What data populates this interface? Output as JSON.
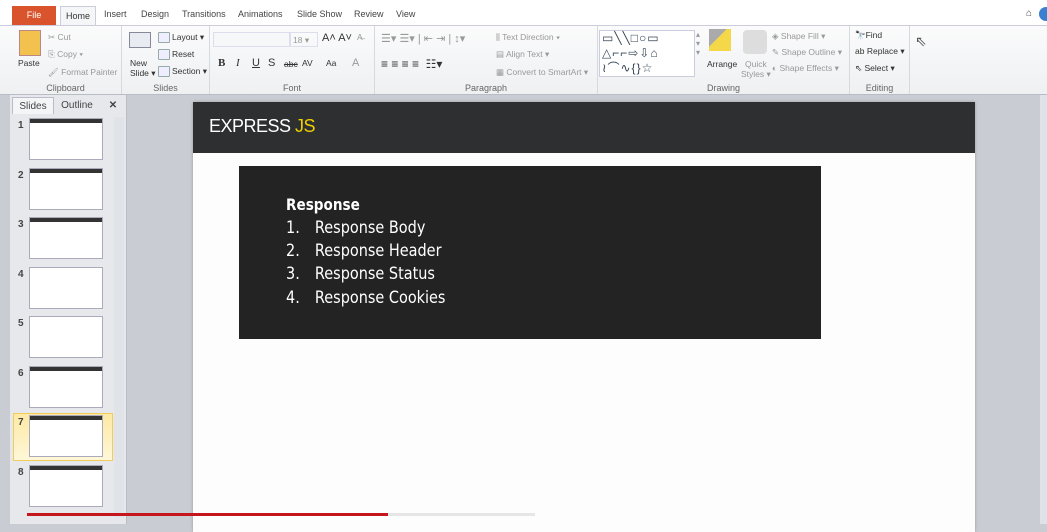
{
  "ribbon_tabs": [
    "File",
    "Home",
    "Insert",
    "Design",
    "Transitions",
    "Animations",
    "Slide Show",
    "Review",
    "View"
  ],
  "active_tab": "Home",
  "clipboard": {
    "label": "Clipboard",
    "paste": "Paste",
    "cut": "Cut",
    "copy": "Copy",
    "format_painter": "Format Painter"
  },
  "slides_group": {
    "label": "Slides",
    "new_slide_1": "New",
    "new_slide_2": "Slide",
    "layout": "Layout",
    "reset": "Reset",
    "section": "Section"
  },
  "font": {
    "label": "Font",
    "size": "18",
    "bold": "B",
    "italic": "I",
    "underline": "U",
    "shadow": "S",
    "strike": "abc",
    "spacing": "AV",
    "case": "Aa",
    "color": "A"
  },
  "paragraph": {
    "label": "Paragraph",
    "text_direction": "Text Direction",
    "align_text": "Align Text",
    "convert": "Convert to SmartArt"
  },
  "drawing": {
    "label": "Drawing",
    "arrange": "Arrange",
    "quick_styles_1": "Quick",
    "quick_styles_2": "Styles",
    "shape_fill": "Shape Fill",
    "shape_outline": "Shape Outline",
    "shape_effects": "Shape Effects"
  },
  "editing": {
    "label": "Editing",
    "find": "Find",
    "replace": "Replace",
    "select": "Select"
  },
  "panel": {
    "tab_slides": "Slides",
    "tab_outline": "Outline",
    "close": "✕",
    "slide_numbers": [
      "1",
      "2",
      "3",
      "4",
      "5",
      "6",
      "7",
      "8"
    ],
    "selected": 7
  },
  "slide": {
    "title_main": "EXPRESS ",
    "title_accent": "JS",
    "heading": "Response",
    "items": [
      {
        "n": "1.",
        "t": "Response Body"
      },
      {
        "n": "2.",
        "t": "Response Header"
      },
      {
        "n": "3.",
        "t": "Response Status"
      },
      {
        "n": "4.",
        "t": "Response Cookies"
      }
    ]
  },
  "video_progress": 0.71,
  "colors": {
    "file_tab": "#d9532c",
    "accent": "#f0d000",
    "header": "#2d2f30",
    "box": "#232323",
    "progress": "#c4161c"
  }
}
